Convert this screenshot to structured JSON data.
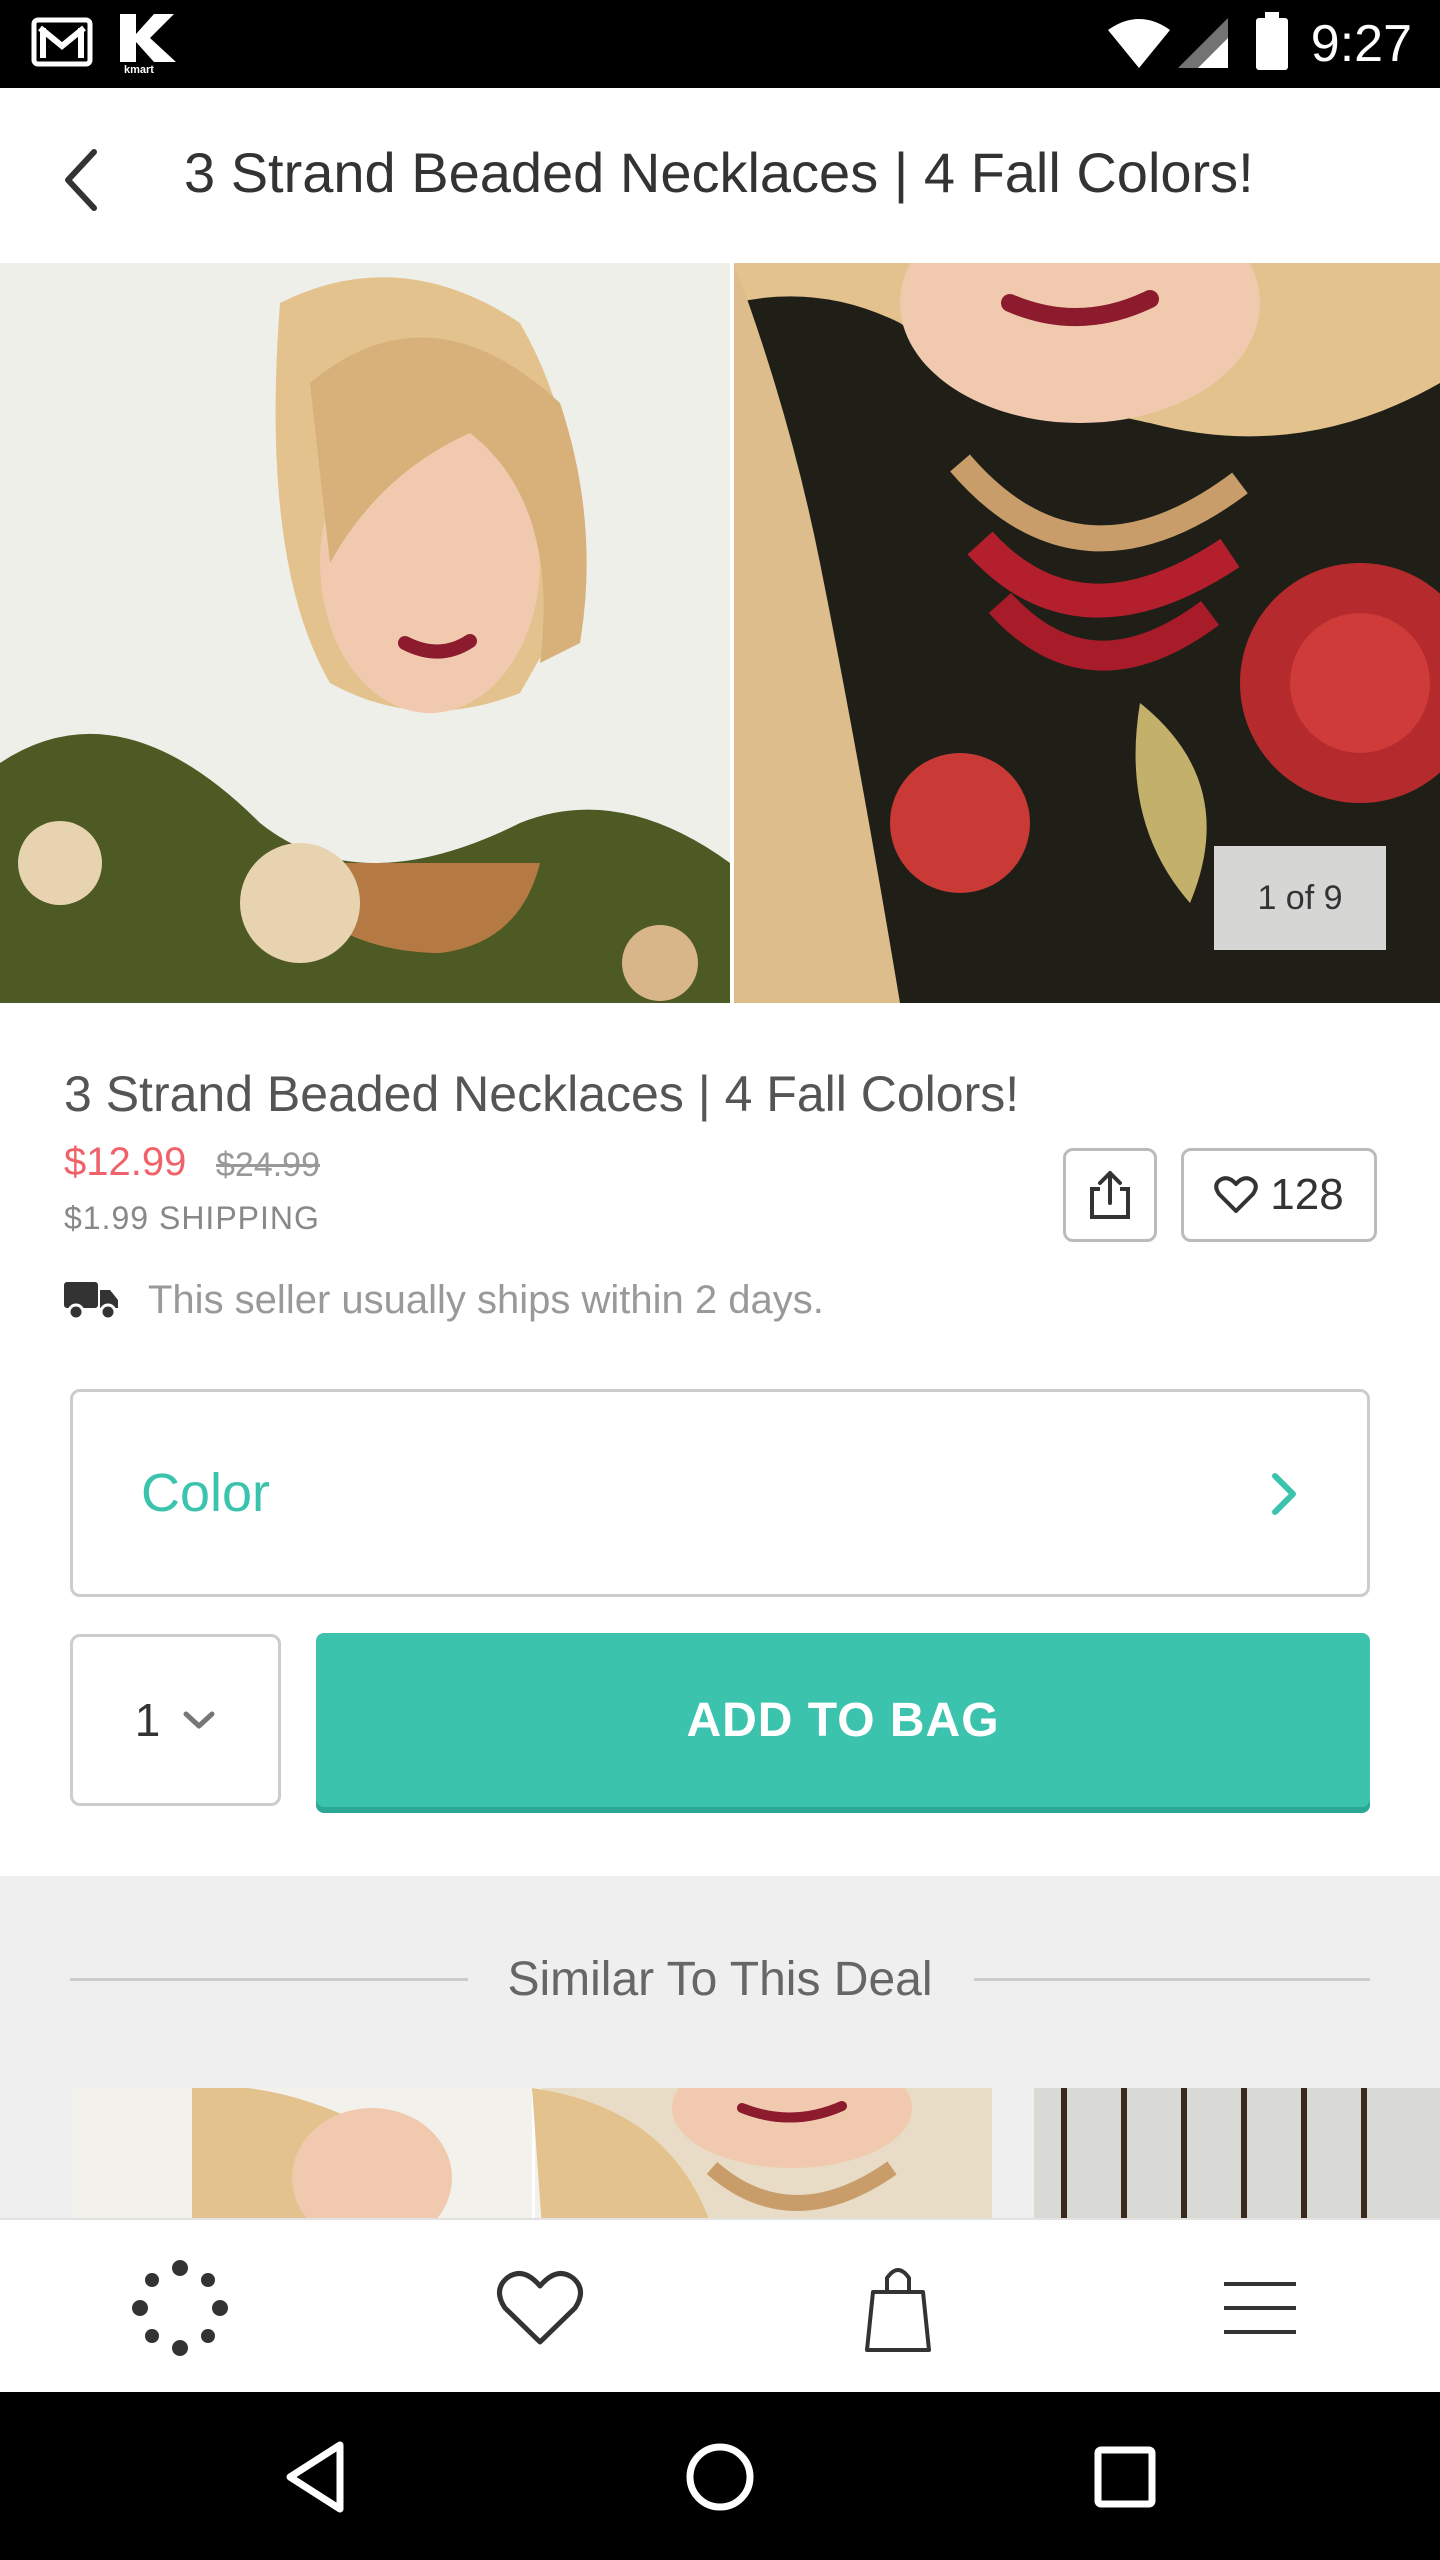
{
  "status_bar": {
    "time": "9:27",
    "notification_icons": [
      "gmail-icon",
      "kmart-icon"
    ],
    "kmart_label": "kmart"
  },
  "header": {
    "title": "3 Strand Beaded Necklaces | 4 Fall Colors!"
  },
  "gallery": {
    "counter": "1 of 9"
  },
  "product": {
    "title": "3 Strand Beaded Necklaces | 4 Fall Colors!",
    "price": "$12.99",
    "original_price": "$24.99",
    "shipping": "$1.99 SHIPPING",
    "favorites_count": "128",
    "ships_note": "This seller usually ships within 2 days."
  },
  "options": {
    "color_label": "Color",
    "quantity": "1"
  },
  "actions": {
    "add_to_bag": "ADD TO BAG"
  },
  "similar": {
    "heading": "Similar To This Deal"
  },
  "bottom_nav": [
    "discover-icon",
    "favorites-icon",
    "bag-icon",
    "menu-icon"
  ],
  "colors": {
    "accent": "#3bc3ad",
    "price": "#f0626a"
  }
}
